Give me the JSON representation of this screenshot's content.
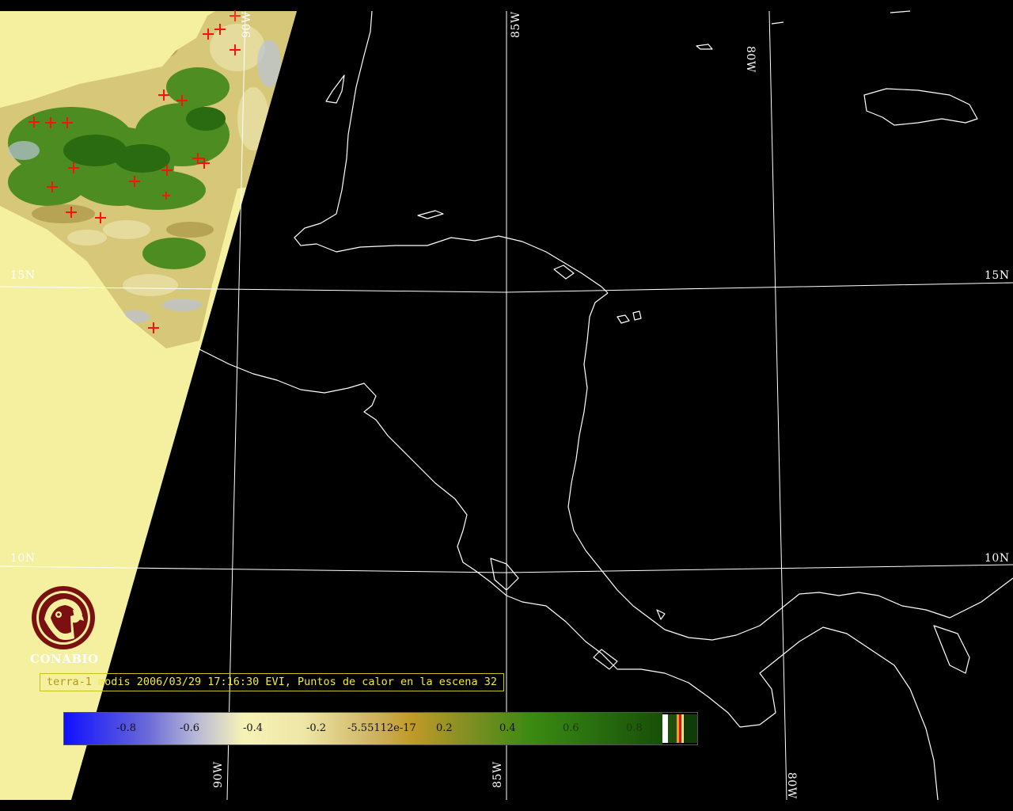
{
  "map": {
    "title": "terra-1 modis 2006/03/29 17:16:30 EVI, Puntos de calor en la escena 32",
    "caption": {
      "satellite": "terra-1",
      "rest": " modis 2006/03/29 17:16:30 EVI, Puntos de calor en la escena 32"
    },
    "grid_labels": {
      "lon_top_90": "90W",
      "lon_top_85": "85W",
      "lon_top_80": "80W",
      "lon_bottom_90": "90W",
      "lon_bottom_85": "85W",
      "lon_bottom_80": "80W",
      "lat_left_15": "15N",
      "lat_right_15": "15N",
      "lat_left_10": "10N",
      "lat_right_10": "10N"
    },
    "logo_text": "CONABIO",
    "colorbar": {
      "ticks": [
        "-0.8",
        "-0.6",
        "-0.4",
        "-0.2",
        "-5.55112e-17",
        "0.2",
        "0.4",
        "0.6",
        "0.8"
      ],
      "colors": {
        "low": "#1010ff",
        "mid_low": "#f6f2a6",
        "mid": "#c8a230",
        "high": "#2f8a10",
        "max": "#184f08"
      }
    },
    "hotspots_count": 19,
    "colors": {
      "background": "#000000",
      "swath_base": "#f4f0a0",
      "coastline": "#ffffff",
      "grid": "#ffffff",
      "hotspot": "#ff1010",
      "logo": "#7a1010"
    }
  }
}
